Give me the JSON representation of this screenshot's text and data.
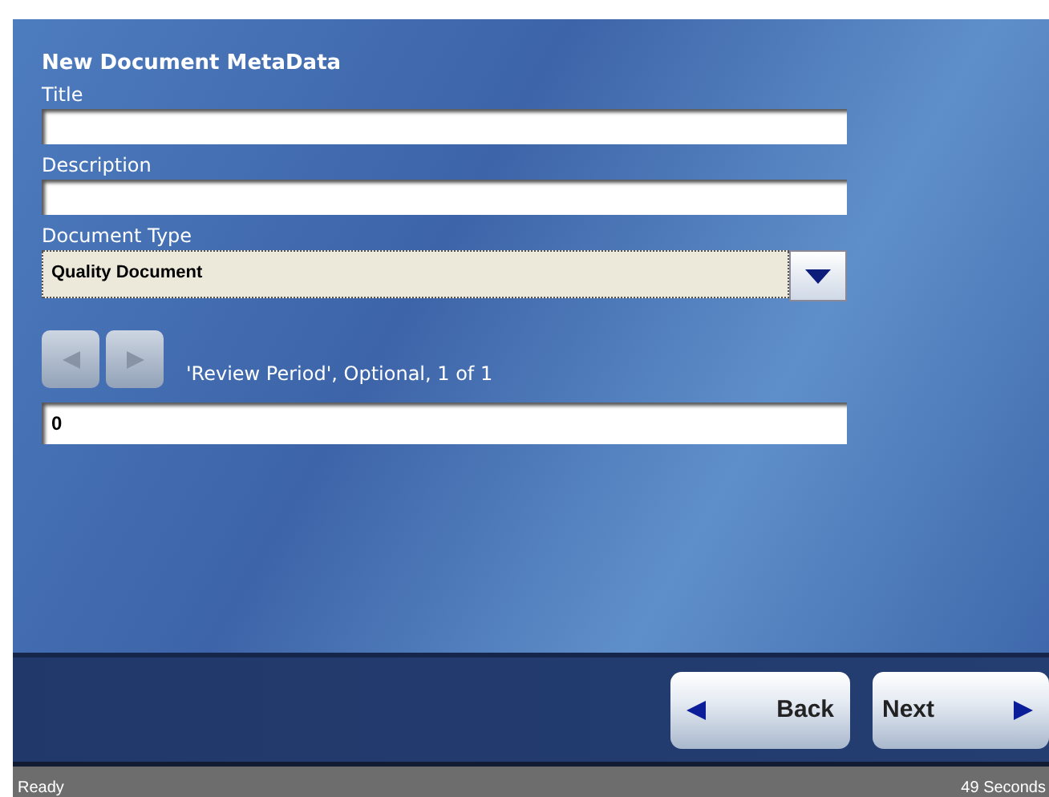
{
  "heading": "New Document MetaData",
  "fields": [
    {
      "kind": "text",
      "label": "Title"
    },
    {
      "kind": "text",
      "label": "Description"
    },
    {
      "kind": "select",
      "label": "Document Type",
      "value": "Quality Document"
    }
  ],
  "pager": {
    "prev_disabled": true,
    "next_disabled": true,
    "caption": "'Review Period', Optional, 1 of 1",
    "value": "0"
  },
  "buttons": [
    {
      "kind": "back",
      "label": "Back"
    },
    {
      "kind": "next",
      "label": "Next"
    }
  ],
  "status_bar": {
    "left": "Ready",
    "right": "49 Seconds"
  }
}
